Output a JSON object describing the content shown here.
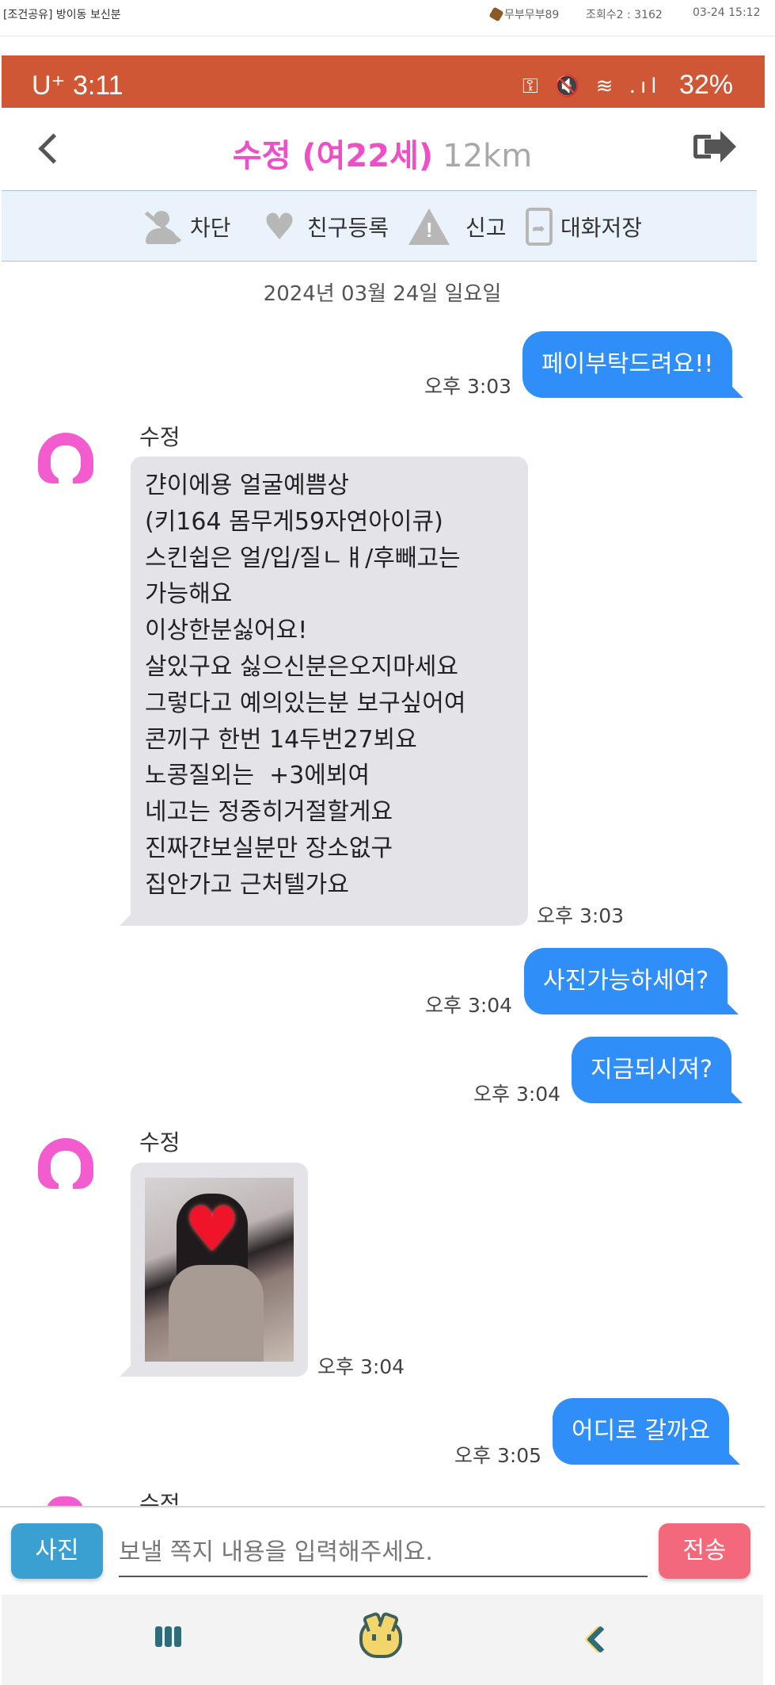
{
  "forum_bar": {
    "title": "[조건공유] 방이동 보신분",
    "user": "무부무부89",
    "views": "조회수2 : 3162",
    "date": "03-24 15:12"
  },
  "status_bar": {
    "carrier_time": "U⁺ 3:11",
    "icons": "⚿ 🔇 ≋ .ıl",
    "battery": "32%"
  },
  "header": {
    "name": "수정 (여22세)",
    "distance": "12km",
    "back_icon": "chevron-left-icon",
    "exit_icon": "exit-icon"
  },
  "actions": [
    {
      "label": "차단",
      "icon": "block-user-icon"
    },
    {
      "label": "친구등록",
      "icon": "heart-icon"
    },
    {
      "label": "신고",
      "icon": "warning-icon"
    },
    {
      "label": "대화저장",
      "icon": "save-chat-icon"
    }
  ],
  "date_separator": "2024년 03월 24일 일요일",
  "messages": [
    {
      "dir": "out",
      "text": "페이부탁드려요!!",
      "time": "오후 3:03"
    },
    {
      "dir": "in",
      "sender": "수정",
      "time": "오후 3:03",
      "lines": [
        "갼이에용 얼굴예쁨상",
        "(키164 몸무게59자연아이큐)",
        "스킨쉽은 얼/입/질ㄴㅒ/후빼고는",
        "가능해요",
        "이상한분싫어요!",
        "살있구요 싫으신분은오지마세요",
        "그렇다고 예의있는분 보구싶어여",
        "콘끼구 한번 14두번27뵈요",
        "노콩질외는  +3에뵈여",
        "네고는 정중히거절할게요",
        "진짜갼보실분만 장소없구",
        "집안가고 근처텔가요"
      ]
    },
    {
      "dir": "out",
      "text": "사진가능하세여?",
      "time": "오후 3:04"
    },
    {
      "dir": "out",
      "text": "지금되시져?",
      "time": "오후 3:04"
    },
    {
      "dir": "in",
      "sender": "수정",
      "time": "오후 3:04",
      "photo": true
    },
    {
      "dir": "out",
      "text": "어디로 갈까요",
      "time": "오후 3:05"
    }
  ],
  "partial_sender": "수정",
  "input": {
    "photo_label": "사진",
    "placeholder": "보낼 쪽지 내용을 입력해주세요.",
    "value": "",
    "send_label": "전송"
  },
  "colors": {
    "status_bar": "#cf5735",
    "accent_name": "#ee4fc6",
    "outgoing_bubble": "#2f8ef8",
    "incoming_bubble": "#e4e3e8",
    "photo_button": "#3aa0d1",
    "send_button": "#f3687a"
  },
  "nav": {
    "recents_icon": "recents-icon",
    "home_icon": "cat-home-icon",
    "back_icon": "back-icon"
  }
}
